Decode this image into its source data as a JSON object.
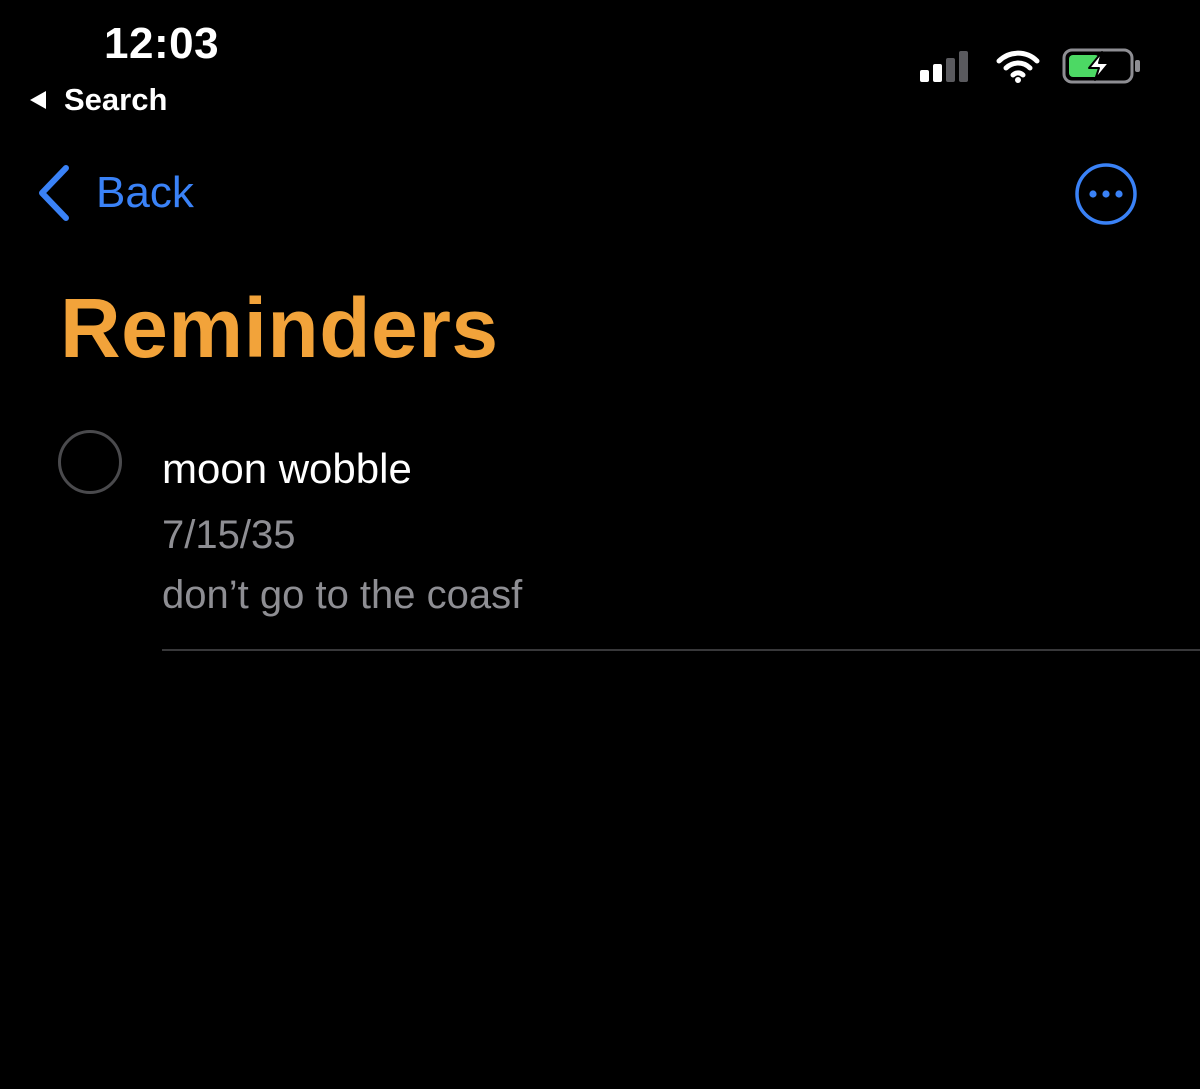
{
  "status_bar": {
    "time": "12:03",
    "return_app_label": "Search",
    "signal_bars_active": 2,
    "signal_bars_total": 4,
    "battery_charging": true
  },
  "nav": {
    "back_label": "Back"
  },
  "list": {
    "title": "Reminders"
  },
  "reminders": [
    {
      "title": "moon wobble",
      "date": "7/15/35",
      "notes": "don’t go to the coasf",
      "completed": false
    }
  ],
  "colors": {
    "background": "#000000",
    "accent_blue": "#3a82f7",
    "title_orange": "#f2a33a",
    "primary_text": "#ffffff",
    "secondary_text": "#8e8e93",
    "circle_border": "#4a4a4d",
    "divider": "#38383a",
    "battery_green": "#4cd964",
    "inactive_signal": "#5a5a5e"
  },
  "icons": {
    "status_back": "back-triangle-icon",
    "wifi": "wifi-icon",
    "signal": "cellular-signal-icon",
    "battery": "battery-charging-icon",
    "nav_back": "chevron-left-icon",
    "more": "ellipsis-circle-icon"
  }
}
